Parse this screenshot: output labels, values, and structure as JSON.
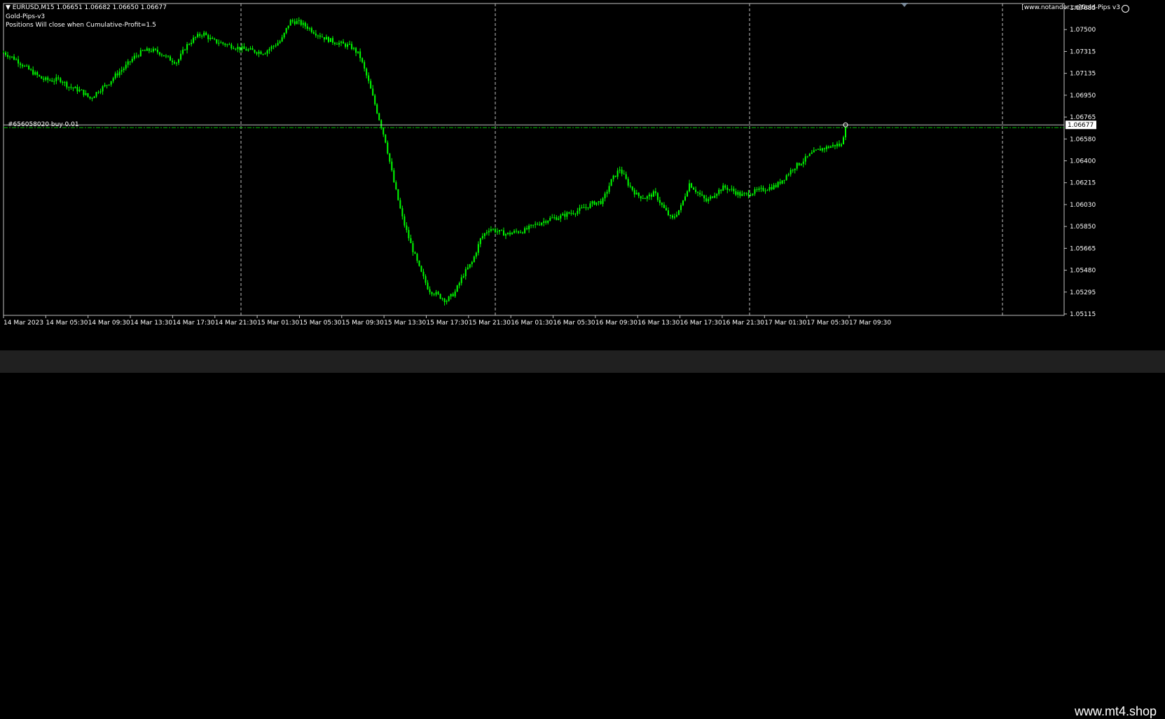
{
  "header": {
    "symbol_line": "▼ EURUSD,M15  1.06651 1.06682 1.06650 1.06677",
    "ea_name": "Gold-Pips-v3",
    "ea_note": "Positions Will close when Cumulative-Profit=1.5",
    "copyright": "[www.notandor.cn]Gold-Pips v3"
  },
  "order_label": "#656058020 buy 0.01",
  "watermark": "www.mt4.shop",
  "colors": {
    "background": "#000000",
    "candle": "#00ff00",
    "grid": "#c0c0c0",
    "order_line": "#00c000",
    "bid_line": "#c0c0c0"
  },
  "chart_data": {
    "type": "candlestick",
    "symbol": "EURUSD",
    "timeframe": "M15",
    "ohlc_last": {
      "open": 1.06651,
      "high": 1.06682,
      "low": 1.0665,
      "close": 1.06677
    },
    "current_price": "1.06677",
    "order_price": 1.0666,
    "ylim": [
      1.0511,
      1.07685
    ],
    "y_ticks": [
      "1.07685",
      "1.07500",
      "1.07315",
      "1.07135",
      "1.06950",
      "1.06765",
      "1.06580",
      "1.06400",
      "1.06215",
      "1.06030",
      "1.05850",
      "1.05665",
      "1.05480",
      "1.05295",
      "1.05115"
    ],
    "x_ticks": [
      "14 Mar 2023",
      "14 Mar 05:30",
      "14 Mar 09:30",
      "14 Mar 13:30",
      "14 Mar 17:30",
      "14 Mar 21:30",
      "15 Mar 01:30",
      "15 Mar 05:30",
      "15 Mar 09:30",
      "15 Mar 13:30",
      "15 Mar 17:30",
      "15 Mar 21:30",
      "16 Mar 01:30",
      "16 Mar 05:30",
      "16 Mar 09:30",
      "16 Mar 13:30",
      "16 Mar 17:30",
      "16 Mar 21:30",
      "17 Mar 01:30",
      "17 Mar 05:30",
      "17 Mar 09:30"
    ],
    "close_path": [
      [
        0,
        1.0728
      ],
      [
        3,
        1.0722
      ],
      [
        5,
        1.0716
      ],
      [
        7,
        1.0711
      ],
      [
        9,
        1.0706
      ],
      [
        11,
        1.0705
      ],
      [
        13,
        1.0706
      ],
      [
        15,
        1.07
      ],
      [
        18,
        1.0696
      ],
      [
        20,
        1.069
      ],
      [
        22,
        1.0697
      ],
      [
        24,
        1.0702
      ],
      [
        26,
        1.071
      ],
      [
        28,
        1.0716
      ],
      [
        30,
        1.0724
      ],
      [
        32,
        1.0729
      ],
      [
        34,
        1.073
      ],
      [
        36,
        1.0728
      ],
      [
        38,
        1.0723
      ],
      [
        40,
        1.072
      ],
      [
        42,
        1.0733
      ],
      [
        44,
        1.074
      ],
      [
        46,
        1.0744
      ],
      [
        48,
        1.0738
      ],
      [
        52,
        1.0734
      ],
      [
        55,
        1.0731
      ],
      [
        58,
        1.0729
      ],
      [
        60,
        1.0728
      ],
      [
        62,
        1.0733
      ],
      [
        64,
        1.0738
      ],
      [
        66,
        1.0754
      ],
      [
        68,
        1.0753
      ],
      [
        70,
        1.0749
      ],
      [
        72,
        1.0744
      ],
      [
        74,
        1.074
      ],
      [
        76,
        1.0737
      ],
      [
        78,
        1.0735
      ],
      [
        80,
        1.0733
      ],
      [
        82,
        1.0726
      ],
      [
        84,
        1.0705
      ],
      [
        86,
        1.068
      ],
      [
        88,
        1.0655
      ],
      [
        90,
        1.062
      ],
      [
        92,
        1.059
      ],
      [
        94,
        1.0568
      ],
      [
        96,
        1.0548
      ],
      [
        98,
        1.0532
      ],
      [
        100,
        1.0528
      ],
      [
        102,
        1.0523
      ],
      [
        104,
        1.053
      ],
      [
        106,
        1.0545
      ],
      [
        108,
        1.0555
      ],
      [
        110,
        1.0575
      ],
      [
        112,
        1.0583
      ],
      [
        114,
        1.058
      ],
      [
        116,
        1.0578
      ],
      [
        118,
        1.058
      ],
      [
        120,
        1.0581
      ],
      [
        122,
        1.0585
      ],
      [
        124,
        1.0588
      ],
      [
        126,
        1.0591
      ],
      [
        128,
        1.0592
      ],
      [
        130,
        1.0595
      ],
      [
        132,
        1.0597
      ],
      [
        134,
        1.06
      ],
      [
        136,
        1.0604
      ],
      [
        138,
        1.0605
      ],
      [
        140,
        1.0622
      ],
      [
        142,
        1.0632
      ],
      [
        144,
        1.0619
      ],
      [
        146,
        1.061
      ],
      [
        148,
        1.0608
      ],
      [
        150,
        1.0612
      ],
      [
        152,
        1.06
      ],
      [
        154,
        1.059
      ],
      [
        156,
        1.06
      ],
      [
        158,
        1.062
      ],
      [
        160,
        1.0612
      ],
      [
        162,
        1.0605
      ],
      [
        164,
        1.0612
      ],
      [
        166,
        1.0617
      ],
      [
        168,
        1.0614
      ],
      [
        170,
        1.061
      ],
      [
        172,
        1.0612
      ],
      [
        174,
        1.0614
      ],
      [
        176,
        1.0616
      ],
      [
        178,
        1.0618
      ],
      [
        180,
        1.0625
      ],
      [
        182,
        1.0633
      ],
      [
        184,
        1.0638
      ],
      [
        186,
        1.0644
      ],
      [
        188,
        1.0648
      ],
      [
        190,
        1.065
      ],
      [
        192,
        1.0652
      ],
      [
        193,
        1.0651
      ],
      [
        194,
        1.06677
      ]
    ]
  }
}
